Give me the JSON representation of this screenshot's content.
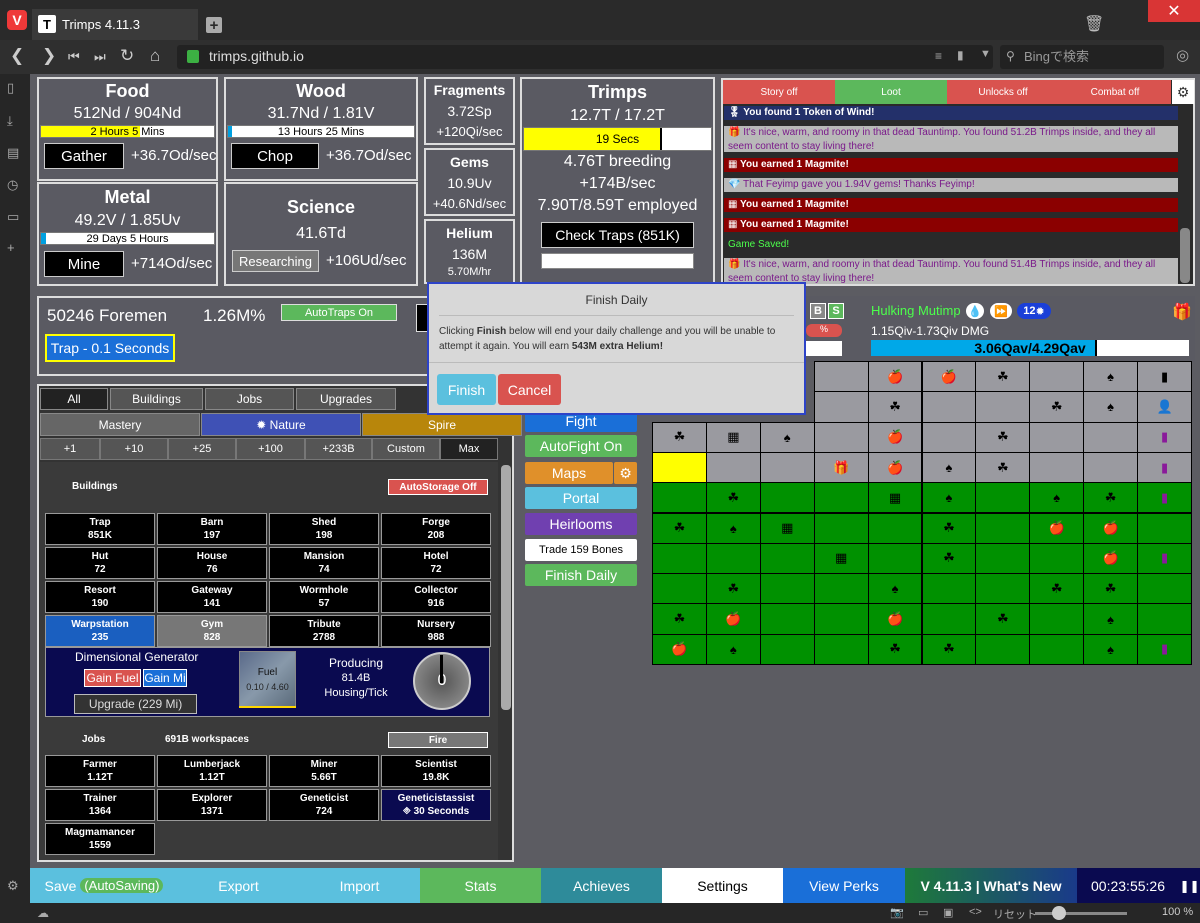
{
  "browser": {
    "tab_title": "Trimps 4.11.3",
    "url": "trimps.github.io",
    "search_placeholder": "Bingで検索",
    "zoom": "100 %",
    "reset": "リセット"
  },
  "resources": {
    "food": {
      "name": "Food",
      "value": "512Nd / 904Nd",
      "bar": "2 Hours 5 Mins",
      "fill": 0.57,
      "button": "Gather",
      "rate": "+36.7Od/sec"
    },
    "wood": {
      "name": "Wood",
      "value": "31.7Nd / 1.81V",
      "bar": "13 Hours 25 Mins",
      "fill": 0.02,
      "button": "Chop",
      "rate": "+36.7Od/sec"
    },
    "metal": {
      "name": "Metal",
      "value": "49.2V / 1.85Uv",
      "bar": "29 Days 5 Hours",
      "fill": 0.03,
      "button": "Mine",
      "rate": "+714Od/sec"
    },
    "science": {
      "name": "Science",
      "value": "41.6Td",
      "button": "Researching",
      "rate": "+106Ud/sec"
    }
  },
  "fragments": {
    "name": "Fragments",
    "value": "3.72Sp",
    "rate": "+120Qi/sec"
  },
  "gems": {
    "name": "Gems",
    "value": "10.9Uv",
    "rate": "+40.6Nd/sec"
  },
  "helium": {
    "name": "Helium",
    "value": "136M",
    "rate": "5.70M/hr"
  },
  "trimps": {
    "name": "Trimps",
    "value": "12.7T / 17.2T",
    "bar": "19 Secs",
    "fill": 0.74,
    "breeding": "4.76T breeding",
    "rate": "+174B/sec",
    "employed": "7.90T/8.59T employed",
    "traps": "Check Traps (851K)"
  },
  "foremen": {
    "count": "50246 Foremen",
    "rate": "1.26M%",
    "autotraps": "AutoTraps On",
    "trap": "Trap - 0.1 Seconds"
  },
  "log": {
    "tabs": [
      "Story off",
      "Loot",
      "Unlocks off",
      "Combat off"
    ],
    "messages": [
      {
        "text": "🎖 You found 1 Token of Wind!",
        "bg": "#23306a",
        "bold": true
      },
      {
        "text": "🎁 It's nice, warm, and roomy in that dead Tauntimp. You found 51.2B Trimps inside, and they all seem content to stay living there!",
        "bg": "#b9b9b9",
        "color": "#7a1a8a",
        "h": 28
      },
      {
        "text": "▦ You earned 1 Magmite!",
        "bg": "#8b0000",
        "bold": true
      },
      {
        "text": "💎 That Feyimp gave you 1.94V gems! Thanks Feyimp!",
        "bg": "#b9b9b9",
        "color": "#7a1a8a"
      },
      {
        "text": "▦ You earned 1 Magmite!",
        "bg": "#8b0000",
        "bold": true
      },
      {
        "text": "▦ You earned 1 Magmite!",
        "bg": "#8b0000",
        "bold": true
      },
      {
        "text": "Game Saved!",
        "bg": "#2a2a2a",
        "color": "#4cff4c"
      },
      {
        "text": "🎁 It's nice, warm, and roomy in that dead Tauntimp. You found 51.4B Trimps inside, and they all seem content to stay living there!",
        "bg": "#b9b9b9",
        "color": "#7a1a8a",
        "h": 28
      }
    ]
  },
  "battle": {
    "enemy": "Hulking Mutimp",
    "badge": "12",
    "dmg": "1.15Qiv-1.73Qiv DMG",
    "health": "3.06Qav/4.29Qav",
    "health_fill": 0.71,
    "letters": [
      "B",
      "S"
    ]
  },
  "dialog": {
    "title": "Finish Daily",
    "body_pre": "Clicking ",
    "body_bold": "Finish",
    "body_mid": " below will end your daily challenge and you will be unable to attempt it again. You will earn ",
    "body_bold2": "543M extra Helium!",
    "finish": "Finish",
    "cancel": "Cancel"
  },
  "buyTabs": [
    "All",
    "Buildings",
    "Jobs",
    "Upgrades"
  ],
  "subTabs": [
    "Mastery",
    "✹ Nature",
    "Spire"
  ],
  "amounts": [
    "+1",
    "+10",
    "+25",
    "+100",
    "+233B",
    "Custom",
    "Max"
  ],
  "buildings": {
    "label": "Buildings",
    "autostorage": "AutoStorage Off",
    "items": [
      [
        "Trap",
        "851K"
      ],
      [
        "Barn",
        "197"
      ],
      [
        "Shed",
        "198"
      ],
      [
        "Forge",
        "208"
      ],
      [
        "Hut",
        "72"
      ],
      [
        "House",
        "76"
      ],
      [
        "Mansion",
        "74"
      ],
      [
        "Hotel",
        "72"
      ],
      [
        "Resort",
        "190"
      ],
      [
        "Gateway",
        "141"
      ],
      [
        "Wormhole",
        "57"
      ],
      [
        "Collector",
        "916"
      ],
      [
        "Warpstation",
        "235"
      ],
      [
        "Gym",
        "828"
      ],
      [
        "Tribute",
        "2788"
      ],
      [
        "Nursery",
        "988"
      ]
    ]
  },
  "dg": {
    "title": "Dimensional Generator",
    "gainfuel": "Gain Fuel",
    "gainmi": "Gain Mi",
    "upgrade": "Upgrade (229 Mi)",
    "fuel": "Fuel",
    "fuelval": "0.10 / 4.60",
    "producing": "Producing",
    "prodval": "81.4B",
    "produnit": "Housing/Tick",
    "dial": "0"
  },
  "jobs": {
    "label": "Jobs",
    "workspaces": "691B workspaces",
    "fire": "Fire",
    "items": [
      [
        "Farmer",
        "1.12T"
      ],
      [
        "Lumberjack",
        "1.12T"
      ],
      [
        "Miner",
        "5.66T"
      ],
      [
        "Scientist",
        "19.8K"
      ],
      [
        "Trainer",
        "1364"
      ],
      [
        "Explorer",
        "1371"
      ],
      [
        "Geneticist",
        "724"
      ],
      [
        "Geneticistassist",
        "🞜 30 Seconds"
      ],
      [
        "Magmamancer",
        "1559"
      ]
    ]
  },
  "actions": {
    "fight": "Fight",
    "autofight": "AutoFight On",
    "maps": "Maps",
    "portal": "Portal",
    "heirlooms": "Heirlooms",
    "bones": "Trade 159 Bones",
    "finishdaily": "Finish Daily"
  },
  "bottombar": [
    "Save",
    "(AutoSaving)",
    "Export",
    "Import",
    "Stats",
    "Achieves",
    "Settings",
    "View Perks",
    "V 4.11.3 | What's New",
    "00:23:55:26"
  ],
  "grid": [
    "xxxxrfgxrx",
    "xxxxxgxgtx",
    "xxxxtxxxxxx",
    "Yxxxxxxxxx",
    "GGGGGGGGGG",
    "GGGGGGGGGG",
    "GGGGGGGGGG",
    "GGGGGGGGGG",
    "GGGGGGGGGG",
    "GGGGGGGGGG"
  ],
  "grid_icons": [
    [
      "",
      "",
      "",
      "",
      "🍎",
      "🍎",
      "☘",
      "",
      "♠",
      "▮"
    ],
    [
      "",
      "",
      "",
      "",
      "☘",
      "",
      "",
      "☘",
      "♠",
      "👤"
    ],
    [
      "☘",
      "▦",
      "♠",
      "",
      "🍎",
      "",
      "☘",
      "",
      "",
      "▮"
    ],
    [
      "",
      "",
      "",
      "🎁",
      "🍎",
      "♠",
      "☘",
      "",
      "",
      "▮"
    ],
    [
      "",
      "☘",
      "",
      "",
      "▦",
      "♠",
      "",
      "♠",
      "☘",
      "▮"
    ],
    [
      "☘",
      "♠",
      "▦",
      "",
      "",
      "☘",
      "",
      "🍎",
      "🍎",
      ""
    ],
    [
      "",
      "",
      "",
      "▦",
      "",
      "☘",
      "",
      "",
      "🍎",
      "▮"
    ],
    [
      "",
      "☘",
      "",
      "",
      "♠",
      "",
      "",
      "☘",
      "☘",
      ""
    ],
    [
      "☘",
      "🍎",
      "",
      "",
      "🍎",
      "",
      "☘",
      "",
      "♠",
      ""
    ],
    [
      "🍎",
      "♠",
      "",
      "",
      "☘",
      "☘",
      "",
      "",
      "♠",
      "▮"
    ]
  ]
}
